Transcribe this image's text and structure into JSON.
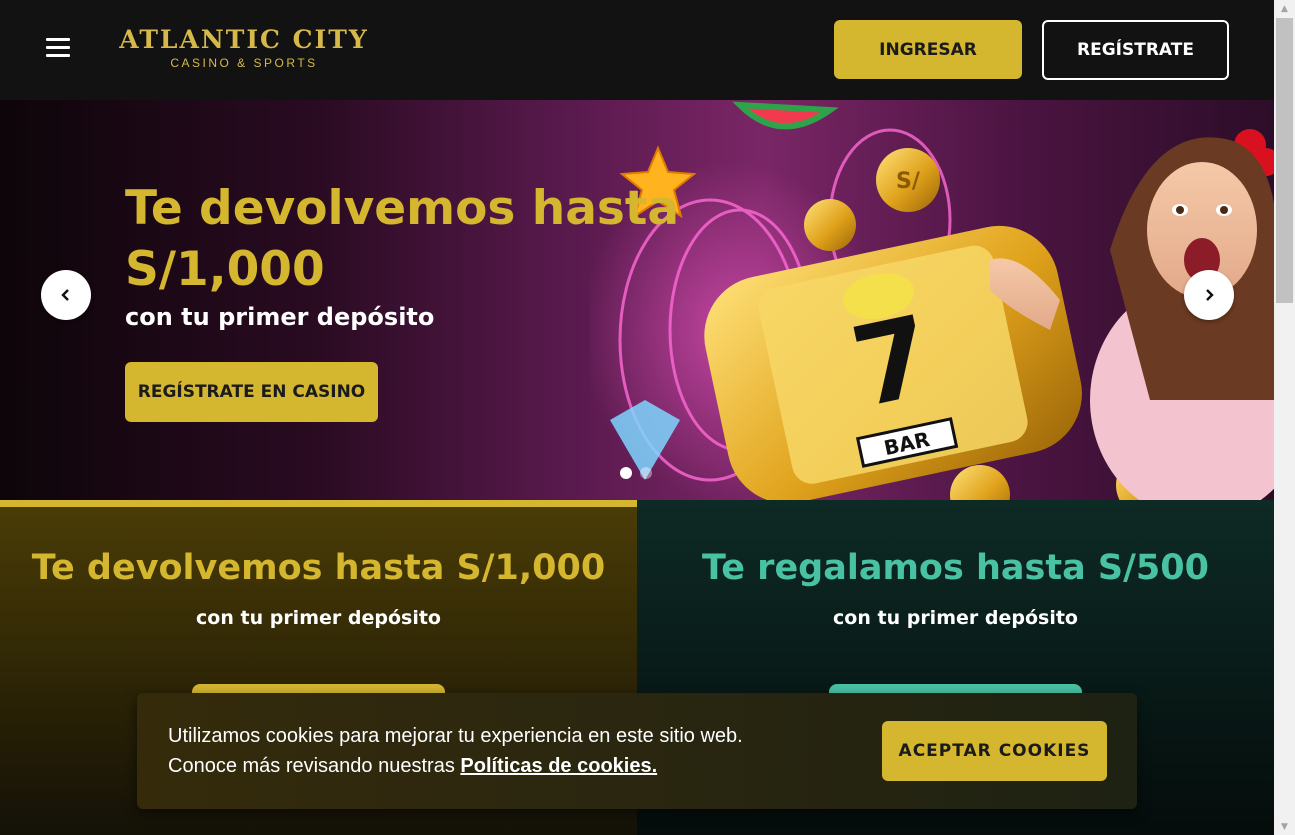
{
  "header": {
    "logo_main": "ATLANTIC CITY",
    "logo_sub": "CASINO & SPORTS",
    "login_label": "INGRESAR",
    "register_label": "REGÍSTRATE"
  },
  "hero": {
    "title": "Te devolvemos hasta S/1,000",
    "subtitle": "con tu primer depósito",
    "cta_label": "REGÍSTRATE EN CASINO",
    "slides_count": 2,
    "active_slide": 1
  },
  "promos": [
    {
      "title": "Te devolvemos hasta S/1,000",
      "subtitle": "con tu primer depósito"
    },
    {
      "title": "Te regalamos hasta S/500",
      "subtitle": "con tu primer depósito"
    }
  ],
  "cookie": {
    "text_line1": "Utilizamos cookies para mejorar tu experiencia en este sitio web.",
    "text_line2_prefix": "Conoce más revisando nuestras",
    "link_label": "Políticas de cookies.",
    "accept_label": "ACEPTAR COOKIES"
  },
  "colors": {
    "gold": "#d4b62f",
    "teal": "#49c2a4",
    "header_bg": "#121212"
  },
  "icons": {
    "menu": "hamburger-menu-icon",
    "prev": "chevron-left-icon",
    "next": "chevron-right-icon"
  }
}
